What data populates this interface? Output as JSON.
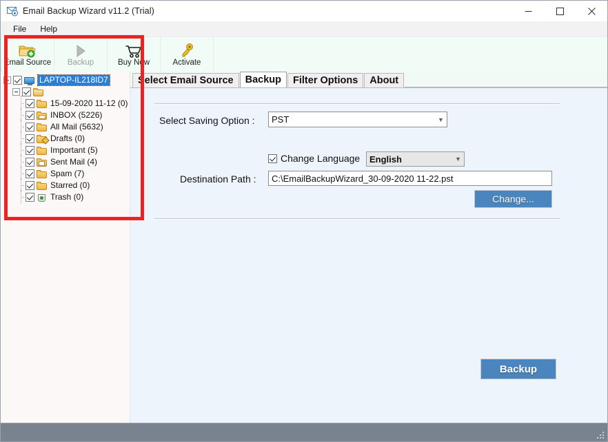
{
  "window": {
    "title": "Email Backup Wizard v11.2 (Trial)",
    "icon": "email-backup-icon",
    "minimize": "—",
    "maximize": "□",
    "close": "✕"
  },
  "menubar": {
    "items": [
      {
        "label": "File"
      },
      {
        "label": "Help"
      }
    ]
  },
  "toolbar": {
    "buttons": [
      {
        "label": "Email Source",
        "icon": "folder-add-icon",
        "enabled": true
      },
      {
        "label": "Backup",
        "icon": "play-triangle-icon",
        "enabled": false
      },
      {
        "label": "Buy Now",
        "icon": "shopping-cart-icon",
        "enabled": true
      },
      {
        "label": "Activate",
        "icon": "key-icon",
        "enabled": true
      }
    ]
  },
  "tree": {
    "root": {
      "label": "LAPTOP-IL218ID7",
      "icon": "monitor-icon",
      "checked": true,
      "selected": true,
      "expanded": true
    },
    "group": {
      "label": "",
      "icon": "open-folder-icon",
      "checked": true,
      "expanded": true
    },
    "folders": [
      {
        "label": "15-09-2020 11-12 (0)",
        "icon": "folder-icon",
        "checked": true
      },
      {
        "label": "INBOX (5226)",
        "icon": "inbox-folder-icon",
        "checked": true
      },
      {
        "label": "All Mail (5632)",
        "icon": "folder-icon",
        "checked": true
      },
      {
        "label": "Drafts (0)",
        "icon": "drafts-folder-icon",
        "checked": true
      },
      {
        "label": "Important (5)",
        "icon": "folder-icon",
        "checked": true
      },
      {
        "label": "Sent Mail (4)",
        "icon": "sent-folder-icon",
        "checked": true
      },
      {
        "label": "Spam (7)",
        "icon": "folder-icon",
        "checked": true
      },
      {
        "label": "Starred (0)",
        "icon": "folder-icon",
        "checked": true
      },
      {
        "label": "Trash (0)",
        "icon": "trash-folder-icon",
        "checked": true
      }
    ]
  },
  "tabs": [
    {
      "label": "Select Email Source",
      "active": false
    },
    {
      "label": "Backup",
      "active": true
    },
    {
      "label": "Filter Options",
      "active": false
    },
    {
      "label": "About",
      "active": false
    }
  ],
  "form": {
    "saving_option_label": "Select Saving Option :",
    "saving_option_value": "PST",
    "change_language_label": "Change Language",
    "change_language_checked": true,
    "language_value": "English",
    "destination_path_label": "Destination Path :",
    "destination_path_value": "C:\\EmailBackupWizard_30-09-2020 11-22.pst",
    "change_button_label": "Change...",
    "backup_button_label": "Backup"
  },
  "annotation": {
    "highlight_color": "#ee2222",
    "region": "email-source-tree-panel"
  },
  "colors": {
    "accent_blue": "#4a85bd",
    "selection_blue": "#2a7fd4",
    "panel_bg": "#eef4fc",
    "left_panel_bg": "#fdf8f8",
    "toolbar_bg": "#f2fcf7",
    "statusbar_bg": "#78838f"
  }
}
